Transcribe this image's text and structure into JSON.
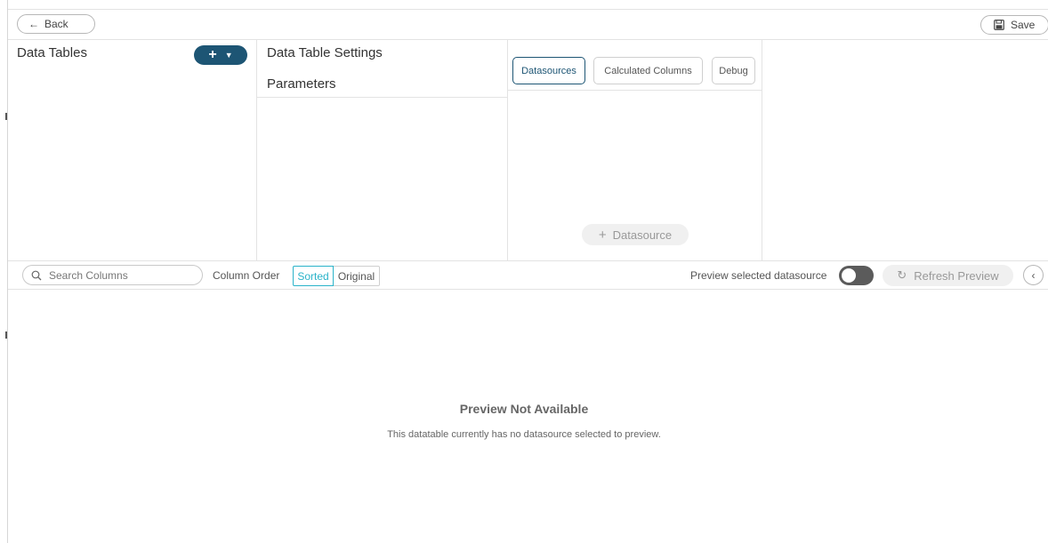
{
  "header": {
    "back_label": "Back",
    "back_icon": "arrow-left-icon",
    "save_label": "Save",
    "save_icon": "floppy-disk-icon"
  },
  "data_tables": {
    "title": "Data Tables",
    "add_button_icon": "plus-icon",
    "add_button_caret": "chevron-down-icon"
  },
  "settings_panel": {
    "items": [
      "Data Table Settings",
      "Parameters"
    ]
  },
  "datasource_panel": {
    "tabs": [
      {
        "label": "Datasources",
        "active": true
      },
      {
        "label": "Calculated Columns",
        "active": false
      },
      {
        "label": "Debug",
        "active": false
      }
    ],
    "add_datasource_label": "Datasource"
  },
  "toolbar": {
    "search_placeholder": "Search Columns",
    "column_order_label": "Column Order",
    "order_options": [
      "Sorted",
      "Original"
    ],
    "selected_order": "Sorted",
    "preview_toggle_label": "Preview selected datasource",
    "preview_toggle_on": false,
    "refresh_label": "Refresh Preview"
  },
  "preview": {
    "title": "Preview Not Available",
    "message": "This datatable currently has no datasource selected to preview."
  },
  "colors": {
    "primary": "#1d5574",
    "accent": "#2ab3c9",
    "toggle_off": "#5b5b5b",
    "disabled_bg": "#f0f0f0"
  }
}
